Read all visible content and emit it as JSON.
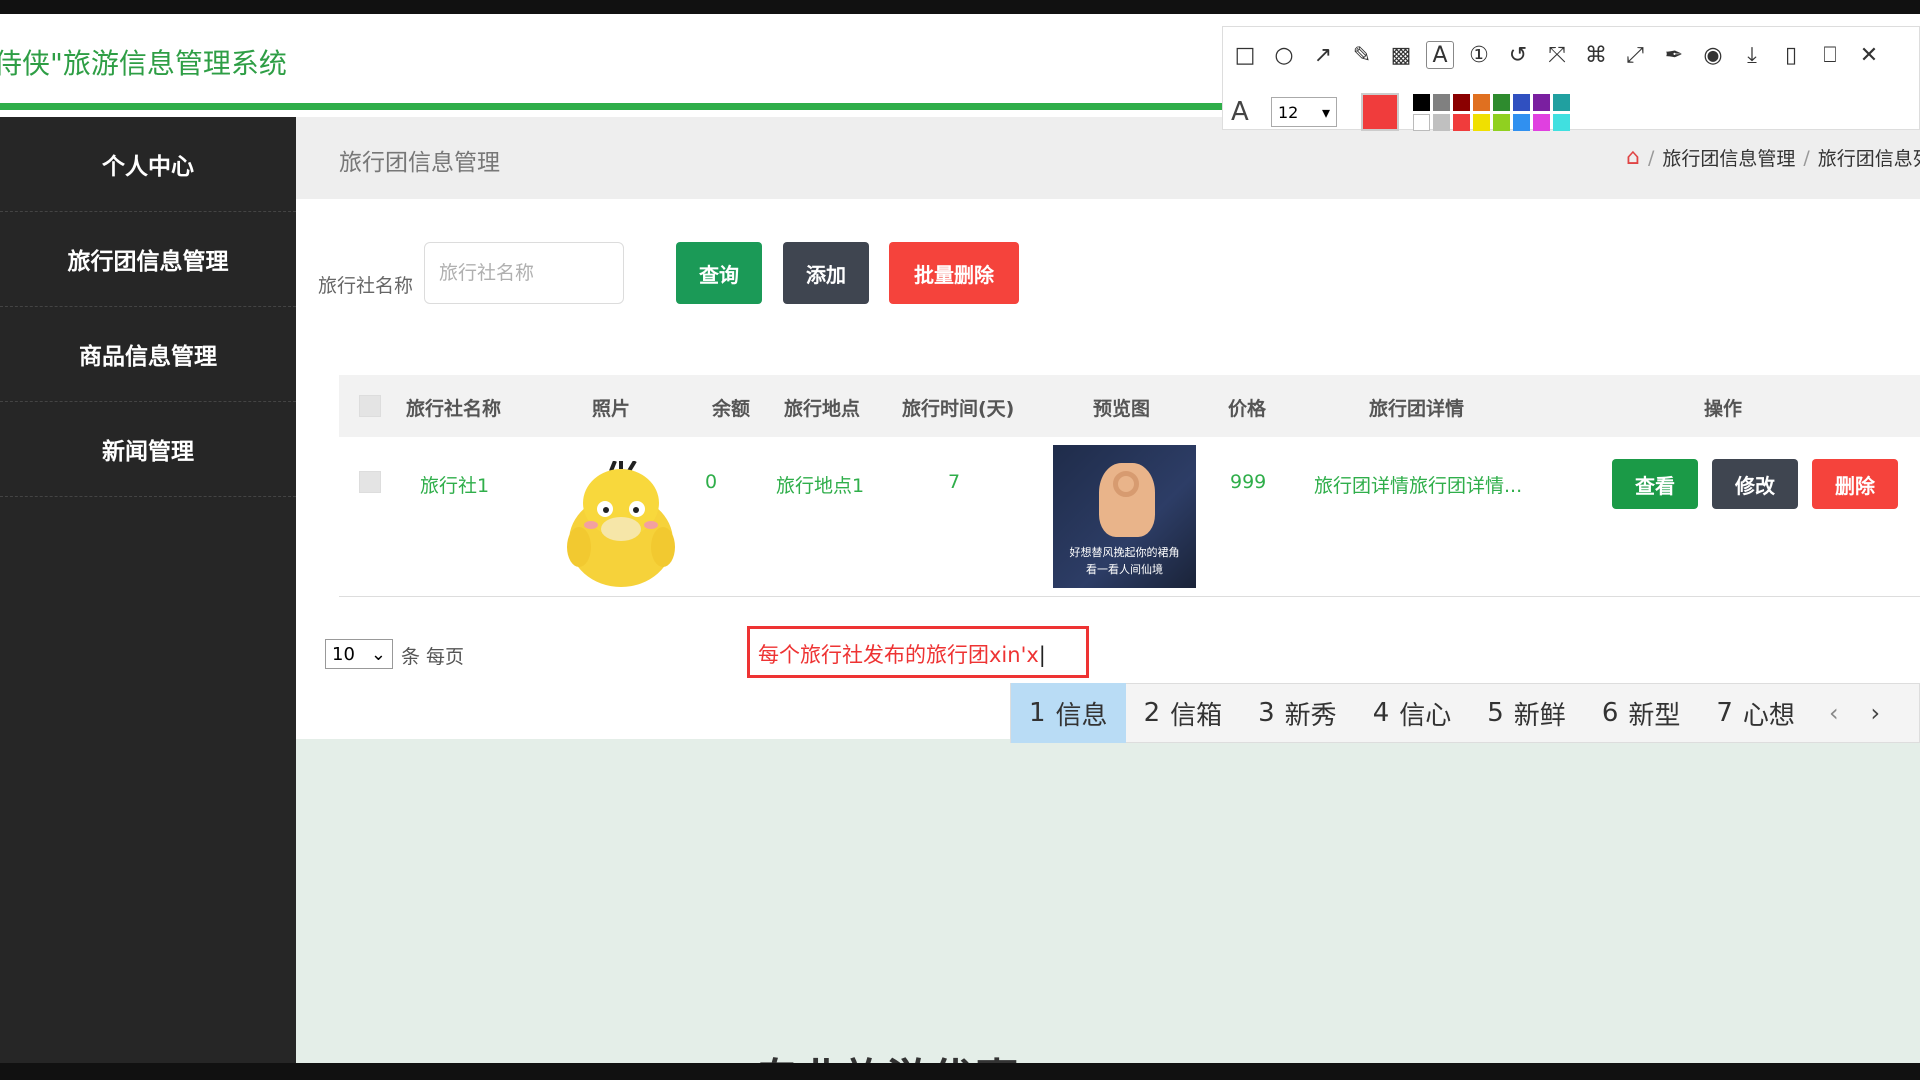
{
  "app": {
    "title": "侍侠\"旅游信息管理系统"
  },
  "annotation_toolbar": {
    "tools": [
      {
        "name": "rectangle-tool-icon",
        "glyph": "□"
      },
      {
        "name": "ellipse-tool-icon",
        "glyph": "○"
      },
      {
        "name": "arrow-tool-icon",
        "glyph": "↗"
      },
      {
        "name": "pen-tool-icon",
        "glyph": "✎"
      },
      {
        "name": "mosaic-tool-icon",
        "glyph": "▩"
      },
      {
        "name": "text-tool-icon",
        "glyph": "A"
      },
      {
        "name": "number-tool-icon",
        "glyph": "①"
      },
      {
        "name": "undo-icon",
        "glyph": "↺"
      },
      {
        "name": "crop-icon",
        "glyph": "⤧"
      },
      {
        "name": "translate-icon",
        "glyph": "⌘"
      },
      {
        "name": "expand-icon",
        "glyph": "⤢"
      },
      {
        "name": "pin-icon",
        "glyph": "✒"
      },
      {
        "name": "record-icon",
        "glyph": "◉"
      },
      {
        "name": "download-icon",
        "glyph": "⤓"
      },
      {
        "name": "save-icon",
        "glyph": "▯"
      },
      {
        "name": "bookmark-icon",
        "glyph": "⎕"
      },
      {
        "name": "close-icon",
        "glyph": "✕"
      }
    ],
    "font_size": "12",
    "current_color": "#f03c3c",
    "palette": [
      "#000000",
      "#808080",
      "#8b0000",
      "#e07020",
      "#2e8b2e",
      "#3050c0",
      "#7a1fa0",
      "#20a0a0",
      "#ffffff",
      "#c0c0c0",
      "#f03c3c",
      "#f0e000",
      "#90d020",
      "#3090f0",
      "#e040e0",
      "#40e0e0"
    ]
  },
  "sidebar": {
    "items": [
      {
        "label": "个人中心"
      },
      {
        "label": "旅行团信息管理"
      },
      {
        "label": "商品信息管理"
      },
      {
        "label": "新闻管理"
      }
    ]
  },
  "page": {
    "title": "旅行团信息管理",
    "breadcrumb": [
      "旅行团信息管理",
      "旅行团信息列"
    ]
  },
  "search": {
    "label": "旅行社名称",
    "placeholder": "旅行社名称",
    "query_label": "查询",
    "add_label": "添加",
    "batch_delete_label": "批量删除"
  },
  "table": {
    "headers": [
      "旅行社名称",
      "照片",
      "余额",
      "旅行地点",
      "旅行时间(天)",
      "预览图",
      "价格",
      "旅行团详情",
      "操作"
    ],
    "rows": [
      {
        "agency": "旅行社1",
        "balance": "0",
        "location": "旅行地点1",
        "days": "7",
        "price": "999",
        "detail": "旅行团详情旅行团详情...",
        "preview_caption": [
          "好想替风挽起你的裙角",
          "看一看人间仙境"
        ],
        "view_label": "查看",
        "edit_label": "修改",
        "delete_label": "删除"
      }
    ]
  },
  "pager": {
    "page_size": "10",
    "page_size_suffix": "条 每页"
  },
  "annotation_text": "每个旅行社发布的旅行团xin'x",
  "ime": {
    "candidates": [
      {
        "index": "1",
        "text": "信息"
      },
      {
        "index": "2",
        "text": "信箱"
      },
      {
        "index": "3",
        "text": "新秀"
      },
      {
        "index": "4",
        "text": "信心"
      },
      {
        "index": "5",
        "text": "新鲜"
      },
      {
        "index": "6",
        "text": "新型"
      },
      {
        "index": "7",
        "text": "心想"
      }
    ],
    "prev_glyph": "‹",
    "next_glyph": "›"
  },
  "bottom_text": "专业旅游优惠"
}
